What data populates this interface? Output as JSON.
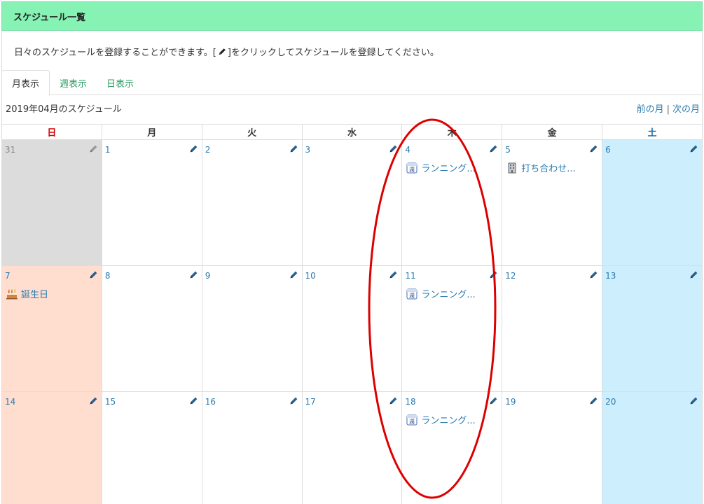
{
  "header": {
    "title": "スケジュール一覧"
  },
  "description": {
    "before": "日々のスケジュールを登録することができます。[",
    "after": "]をクリックしてスケジュールを登録してください。"
  },
  "tabs": [
    {
      "label": "月表示",
      "active": true
    },
    {
      "label": "週表示",
      "active": false
    },
    {
      "label": "日表示",
      "active": false
    }
  ],
  "month_title": "2019年04月のスケジュール",
  "nav": {
    "prev": "前の月",
    "separator": "|",
    "next": "次の月"
  },
  "weekdays": [
    "日",
    "月",
    "火",
    "水",
    "木",
    "金",
    "土"
  ],
  "weeks": [
    [
      {
        "day": "31",
        "other_month": true
      },
      {
        "day": "1"
      },
      {
        "day": "2"
      },
      {
        "day": "3"
      },
      {
        "day": "4",
        "event": {
          "icon": "weekly-icon",
          "label": "ランニング..."
        }
      },
      {
        "day": "5",
        "event": {
          "icon": "building-icon",
          "label": "打ち合わせ..."
        }
      },
      {
        "day": "6"
      }
    ],
    [
      {
        "day": "7",
        "event": {
          "icon": "cake-icon",
          "label": "誕生日"
        }
      },
      {
        "day": "8"
      },
      {
        "day": "9"
      },
      {
        "day": "10"
      },
      {
        "day": "11",
        "event": {
          "icon": "weekly-icon",
          "label": "ランニング..."
        }
      },
      {
        "day": "12"
      },
      {
        "day": "13"
      }
    ],
    [
      {
        "day": "14"
      },
      {
        "day": "15"
      },
      {
        "day": "16"
      },
      {
        "day": "17"
      },
      {
        "day": "18",
        "event": {
          "icon": "weekly-icon",
          "label": "ランニング..."
        }
      },
      {
        "day": "19"
      },
      {
        "day": "20"
      }
    ]
  ],
  "colors": {
    "header_bg": "#86f2b4",
    "link": "#2a7ab0",
    "tab_link": "#2a9d63",
    "sunday": "#d40000",
    "saturday": "#1a6aa8",
    "sunday_bg": "#ffdecf",
    "saturday_bg": "#cdeefd",
    "other_month_bg": "#dcdcdc",
    "annotation": "#dd0000"
  }
}
